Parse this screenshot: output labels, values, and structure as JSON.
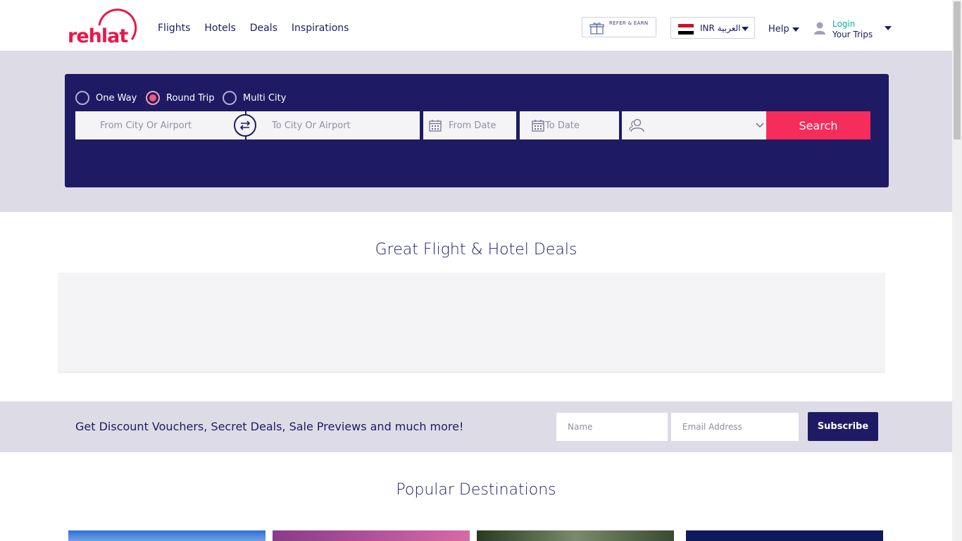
{
  "header": {
    "logo_text": "rehlat",
    "nav": [
      "Flights",
      "Hotels",
      "Deals",
      "Inspirations"
    ],
    "refer_label": "REFER & EARN",
    "language_label": "INR العربية",
    "help_label": "Help",
    "login_label": "Login",
    "trips_label": "Your Trips"
  },
  "search": {
    "trip_types": [
      {
        "label": "One Way",
        "selected": false
      },
      {
        "label": "Round Trip",
        "selected": true
      },
      {
        "label": "Multi City",
        "selected": false
      }
    ],
    "from_placeholder": "From City Or Airport",
    "to_placeholder": "To City Or Airport",
    "from_date_placeholder": "From Date",
    "to_date_placeholder": "To Date",
    "search_label": "Search"
  },
  "deals": {
    "title": "Great Flight & Hotel Deals"
  },
  "subscribe": {
    "text": "Get Discount Vouchers, Secret Deals, Sale Previews and much more!",
    "name_placeholder": "Name",
    "email_placeholder": "Email Address",
    "button_label": "Subscribe"
  },
  "popular": {
    "title": "Popular Destinations"
  },
  "colors": {
    "brand_red": "#e8174a",
    "navy": "#1e1b64",
    "search_button": "#f62c5a",
    "band": "#dddbe6",
    "login_teal": "#00b3a4"
  },
  "icons": {
    "refer": "gift-icon",
    "language": "egypt-flag-icon",
    "user": "user-icon",
    "swap": "swap-arrows-icon",
    "date": "calendar-icon",
    "passengers": "passengers-icon"
  }
}
